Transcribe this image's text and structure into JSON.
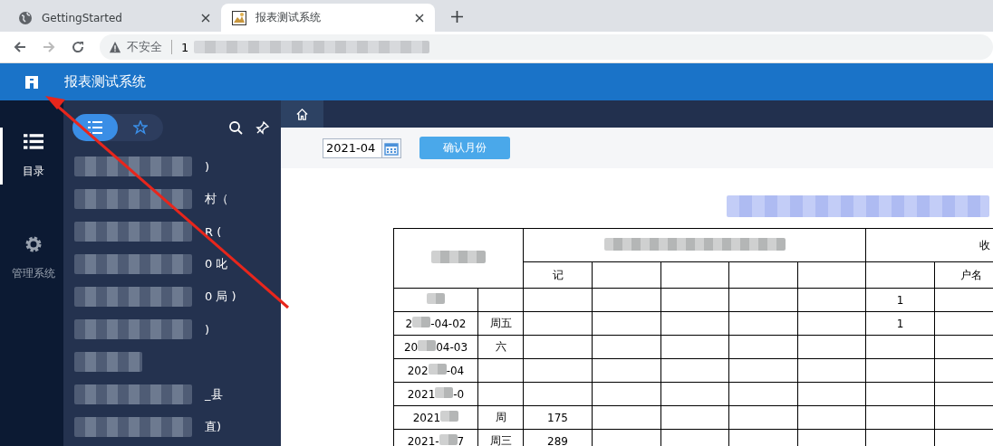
{
  "browser": {
    "tabs": [
      {
        "title": "GettingStarted",
        "selected": false
      },
      {
        "title": "报表测试系统",
        "selected": true
      }
    ],
    "address": {
      "security": "不安全",
      "url": "1"
    }
  },
  "app": {
    "title": "报表测试系统"
  },
  "rail": [
    {
      "label": "目录",
      "selected": true
    },
    {
      "label": "管理系统",
      "selected": false
    }
  ],
  "sidebar": {
    "toggle": [
      {
        "selected": true
      },
      {
        "selected": false
      }
    ],
    "items": [
      {
        "tail": ")"
      },
      {
        "tail": "村（"
      },
      {
        "tail": "R ("
      },
      {
        "tail": "0 叱"
      },
      {
        "tail": "0 局 )"
      },
      {
        "tail": ")"
      },
      {
        "kind": "blurred"
      },
      {
        "tail": "_县"
      },
      {
        "tail": "直)"
      }
    ]
  },
  "month_picker": {
    "value": "2021-04",
    "button": "确认月份"
  },
  "report": {
    "headers": {
      "row2_first": "记",
      "income_group": "收",
      "account_name": "户名"
    },
    "rows": [
      {
        "income": "1"
      },
      {
        "date_start": "2",
        "date_end": "-04-02",
        "day": "周五",
        "income": "1"
      },
      {
        "date_start": "20",
        "date_end": "04-03",
        "day": "六"
      },
      {
        "date_start": "202",
        "date_end": "-04"
      },
      {
        "date_start": "2021",
        "date_end": "-0"
      },
      {
        "date_start": "2021",
        "day": "周",
        "count": "175"
      },
      {
        "date_start": "2021-",
        "date_end": "7",
        "day": "周三",
        "count": "289"
      }
    ]
  }
}
